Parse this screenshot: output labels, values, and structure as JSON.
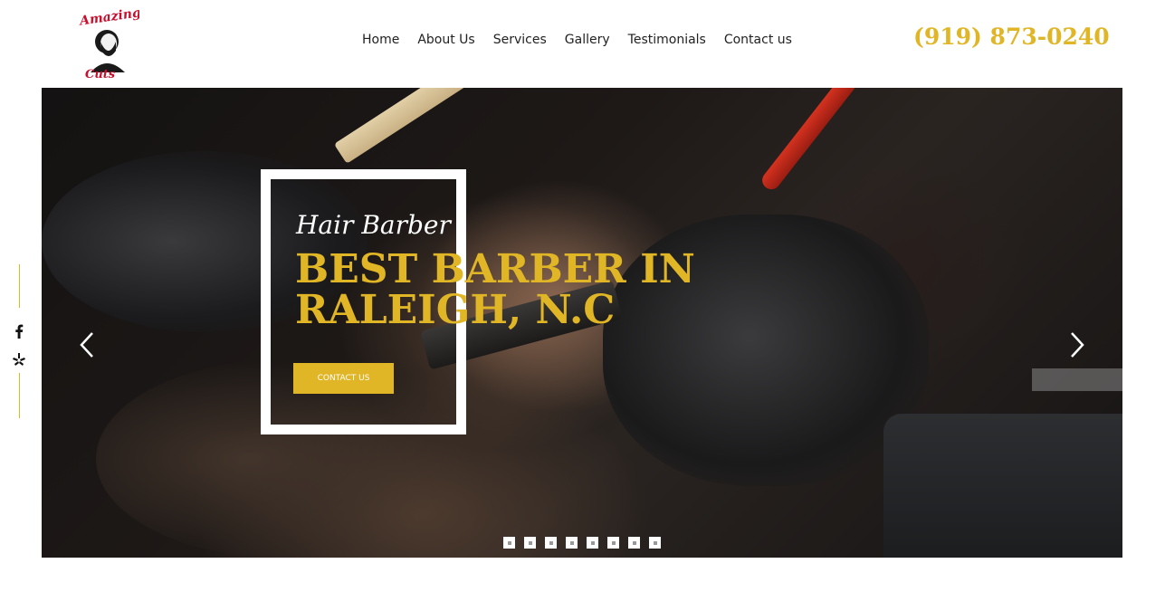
{
  "header": {
    "logo_alt": "Amazing Cuts",
    "nav": [
      "Home",
      "About Us",
      "Services",
      "Gallery",
      "Testimonials",
      "Contact us"
    ],
    "phone": "(919) 873-0240"
  },
  "social": {
    "icons": [
      "facebook-icon",
      "yelp-icon"
    ]
  },
  "hero": {
    "subtitle": "Hair Barber",
    "title": "BEST BARBER IN RALEIGH, N.C",
    "cta_label": "CONTACT US",
    "slide_count": 8,
    "arrows": [
      "chevron-left-icon",
      "chevron-right-icon"
    ]
  },
  "colors": {
    "accent": "#e0b526",
    "text": "#222222",
    "frame": "#ffffff"
  }
}
